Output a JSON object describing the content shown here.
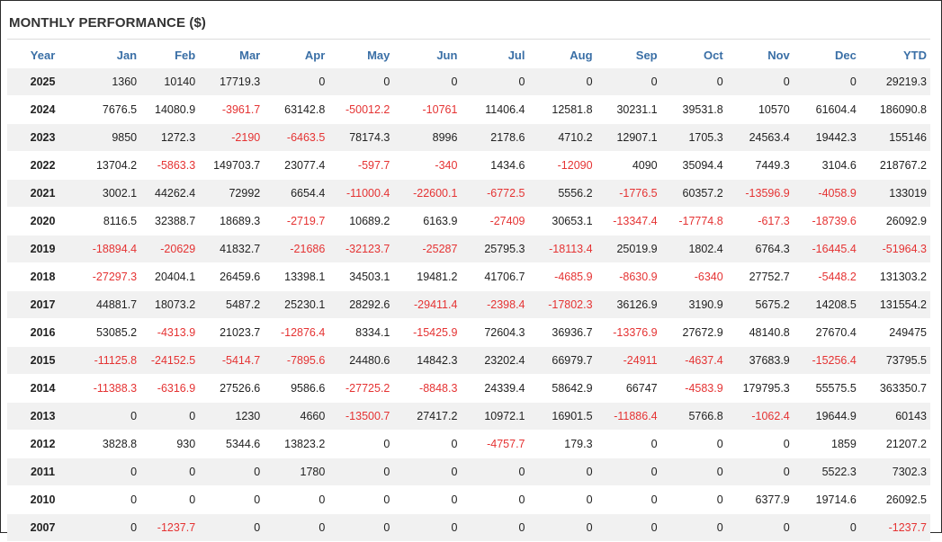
{
  "title": "MONTHLY PERFORMANCE ($)",
  "colors": {
    "header_text": "#3a6fa6",
    "negative": "#e53333",
    "stripe": "#f1f1f1"
  },
  "headers": [
    "Year",
    "Jan",
    "Feb",
    "Mar",
    "Apr",
    "May",
    "Jun",
    "Jul",
    "Aug",
    "Sep",
    "Oct",
    "Nov",
    "Dec",
    "YTD"
  ],
  "rows": [
    [
      "2025",
      "1360",
      "10140",
      "17719.3",
      "0",
      "0",
      "0",
      "0",
      "0",
      "0",
      "0",
      "0",
      "0",
      "29219.3"
    ],
    [
      "2024",
      "7676.5",
      "14080.9",
      "-3961.7",
      "63142.8",
      "-50012.2",
      "-10761",
      "11406.4",
      "12581.8",
      "30231.1",
      "39531.8",
      "10570",
      "61604.4",
      "186090.8"
    ],
    [
      "2023",
      "9850",
      "1272.3",
      "-2190",
      "-6463.5",
      "78174.3",
      "8996",
      "2178.6",
      "4710.2",
      "12907.1",
      "1705.3",
      "24563.4",
      "19442.3",
      "155146"
    ],
    [
      "2022",
      "13704.2",
      "-5863.3",
      "149703.7",
      "23077.4",
      "-597.7",
      "-340",
      "1434.6",
      "-12090",
      "4090",
      "35094.4",
      "7449.3",
      "3104.6",
      "218767.2"
    ],
    [
      "2021",
      "3002.1",
      "44262.4",
      "72992",
      "6654.4",
      "-11000.4",
      "-22600.1",
      "-6772.5",
      "5556.2",
      "-1776.5",
      "60357.2",
      "-13596.9",
      "-4058.9",
      "133019"
    ],
    [
      "2020",
      "8116.5",
      "32388.7",
      "18689.3",
      "-2719.7",
      "10689.2",
      "6163.9",
      "-27409",
      "30653.1",
      "-13347.4",
      "-17774.8",
      "-617.3",
      "-18739.6",
      "26092.9"
    ],
    [
      "2019",
      "-18894.4",
      "-20629",
      "41832.7",
      "-21686",
      "-32123.7",
      "-25287",
      "25795.3",
      "-18113.4",
      "25019.9",
      "1802.4",
      "6764.3",
      "-16445.4",
      "-51964.3"
    ],
    [
      "2018",
      "-27297.3",
      "20404.1",
      "26459.6",
      "13398.1",
      "34503.1",
      "19481.2",
      "41706.7",
      "-4685.9",
      "-8630.9",
      "-6340",
      "27752.7",
      "-5448.2",
      "131303.2"
    ],
    [
      "2017",
      "44881.7",
      "18073.2",
      "5487.2",
      "25230.1",
      "28292.6",
      "-29411.4",
      "-2398.4",
      "-17802.3",
      "36126.9",
      "3190.9",
      "5675.2",
      "14208.5",
      "131554.2"
    ],
    [
      "2016",
      "53085.2",
      "-4313.9",
      "21023.7",
      "-12876.4",
      "8334.1",
      "-15425.9",
      "72604.3",
      "36936.7",
      "-13376.9",
      "27672.9",
      "48140.8",
      "27670.4",
      "249475"
    ],
    [
      "2015",
      "-11125.8",
      "-24152.5",
      "-5414.7",
      "-7895.6",
      "24480.6",
      "14842.3",
      "23202.4",
      "66979.7",
      "-24911",
      "-4637.4",
      "37683.9",
      "-15256.4",
      "73795.5"
    ],
    [
      "2014",
      "-11388.3",
      "-6316.9",
      "27526.6",
      "9586.6",
      "-27725.2",
      "-8848.3",
      "24339.4",
      "58642.9",
      "66747",
      "-4583.9",
      "179795.3",
      "55575.5",
      "363350.7"
    ],
    [
      "2013",
      "0",
      "0",
      "1230",
      "4660",
      "-13500.7",
      "27417.2",
      "10972.1",
      "16901.5",
      "-11886.4",
      "5766.8",
      "-1062.4",
      "19644.9",
      "60143"
    ],
    [
      "2012",
      "3828.8",
      "930",
      "5344.6",
      "13823.2",
      "0",
      "0",
      "-4757.7",
      "179.3",
      "0",
      "0",
      "0",
      "1859",
      "21207.2"
    ],
    [
      "2011",
      "0",
      "0",
      "0",
      "1780",
      "0",
      "0",
      "0",
      "0",
      "0",
      "0",
      "0",
      "5522.3",
      "7302.3"
    ],
    [
      "2010",
      "0",
      "0",
      "0",
      "0",
      "0",
      "0",
      "0",
      "0",
      "0",
      "0",
      "6377.9",
      "19714.6",
      "26092.5"
    ],
    [
      "2007",
      "0",
      "-1237.7",
      "0",
      "0",
      "0",
      "0",
      "0",
      "0",
      "0",
      "0",
      "0",
      "0",
      "-1237.7"
    ]
  ]
}
